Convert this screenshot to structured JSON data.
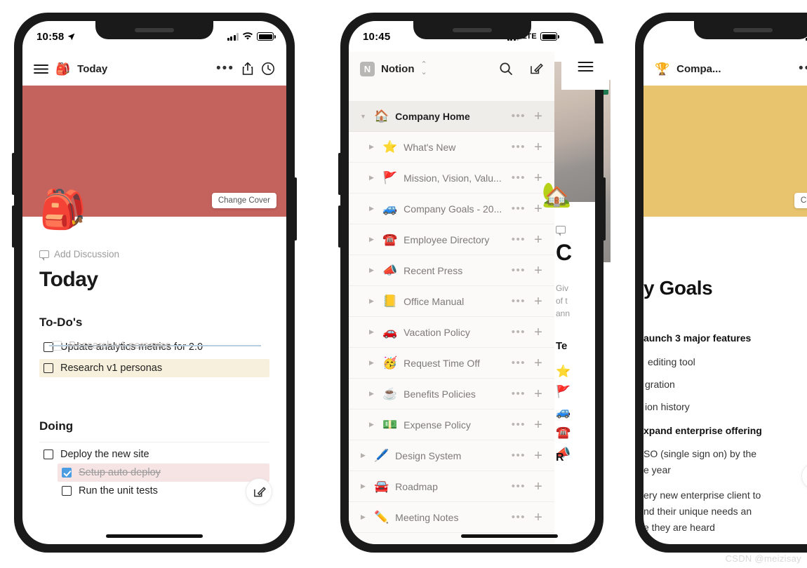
{
  "watermark": "CSDN @meizisay",
  "phone1": {
    "status": {
      "time": "10:58",
      "signal_icon": "cellular-signal-icon",
      "wifi_icon": "wifi-icon",
      "battery_icon": "battery-icon",
      "location_icon": "location-arrow-icon"
    },
    "topbar": {
      "menu_icon": "hamburger-menu-icon",
      "page_emoji": "🎒",
      "title": "Today",
      "more_icon": "more-options-icon",
      "share_icon": "share-icon",
      "history_icon": "history-clock-icon"
    },
    "cover": {
      "color": "#c4625d",
      "change_cover_label": "Change Cover"
    },
    "page_emoji": "🎒",
    "discussion_label": "Add Discussion",
    "page_title": "Today",
    "sections": [
      {
        "heading": "To-Do's",
        "dragging_item": "Research v1 personas",
        "items": [
          {
            "text": "Update analytics metrics for 2.0",
            "checked": false,
            "highlight": "none"
          },
          {
            "text": "Research v1 personas",
            "checked": false,
            "highlight": "yellow"
          }
        ]
      },
      {
        "heading": "Doing",
        "items": [
          {
            "text": "Deploy the new site",
            "checked": false,
            "highlight": "none",
            "indent": false
          },
          {
            "text": "Setup auto deploy",
            "checked": true,
            "highlight": "pink",
            "indent": true
          },
          {
            "text": "Run the unit tests",
            "checked": false,
            "highlight": "none",
            "indent": true
          }
        ]
      }
    ],
    "fab_icon": "compose-edit-icon"
  },
  "phone2": {
    "status": {
      "time": "10:45",
      "network": "LTE",
      "signal_icon": "cellular-signal-icon",
      "battery_icon": "battery-icon"
    },
    "topbar": {
      "logo_letter": "N",
      "workspace": "Notion",
      "switcher_icon": "up-down-chevron-icon",
      "search_icon": "search-icon",
      "compose_icon": "compose-edit-icon"
    },
    "nav": [
      {
        "emoji": "🏠",
        "label": "Company Home",
        "root": true,
        "caret": "▼",
        "more_icon": "more-options-icon",
        "add_icon": "add-page-icon"
      },
      {
        "emoji": "⭐",
        "label": "What's New",
        "root": false,
        "caret": "▶",
        "more_icon": "more-options-icon",
        "add_icon": "add-page-icon"
      },
      {
        "emoji": "🚩",
        "label": "Mission, Vision, Valu...",
        "root": false,
        "caret": "▶",
        "more_icon": "more-options-icon",
        "add_icon": "add-page-icon"
      },
      {
        "emoji": "🚙",
        "label": "Company Goals - 20...",
        "root": false,
        "caret": "▶",
        "more_icon": "more-options-icon",
        "add_icon": "add-page-icon"
      },
      {
        "emoji": "☎️",
        "label": "Employee Directory",
        "root": false,
        "caret": "▶",
        "more_icon": "more-options-icon",
        "add_icon": "add-page-icon"
      },
      {
        "emoji": "📣",
        "label": "Recent Press",
        "root": false,
        "caret": "▶",
        "more_icon": "more-options-icon",
        "add_icon": "add-page-icon"
      },
      {
        "emoji": "📒",
        "label": "Office Manual",
        "root": false,
        "caret": "▶",
        "more_icon": "more-options-icon",
        "add_icon": "add-page-icon"
      },
      {
        "emoji": "🚗",
        "label": "Vacation Policy",
        "root": false,
        "caret": "▶",
        "more_icon": "more-options-icon",
        "add_icon": "add-page-icon"
      },
      {
        "emoji": "🥳",
        "label": "Request Time Off",
        "root": false,
        "caret": "▶",
        "more_icon": "more-options-icon",
        "add_icon": "add-page-icon"
      },
      {
        "emoji": "☕",
        "label": "Benefits Policies",
        "root": false,
        "caret": "▶",
        "more_icon": "more-options-icon",
        "add_icon": "add-page-icon"
      },
      {
        "emoji": "💵",
        "label": "Expense Policy",
        "root": false,
        "caret": "▶",
        "more_icon": "more-options-icon",
        "add_icon": "add-page-icon"
      },
      {
        "emoji": "🖊️",
        "label": "Design System",
        "root": false,
        "caret": "▶",
        "top": true,
        "more_icon": "more-options-icon",
        "add_icon": "add-page-icon"
      },
      {
        "emoji": "🚘",
        "label": "Roadmap",
        "root": false,
        "caret": "▶",
        "top": true,
        "more_icon": "more-options-icon",
        "add_icon": "add-page-icon"
      },
      {
        "emoji": "✏️",
        "label": "Meeting Notes",
        "root": false,
        "caret": "▶",
        "top": true,
        "more_icon": "more-options-icon",
        "add_icon": "add-page-icon"
      }
    ]
  },
  "peek": {
    "emoji": "🏡",
    "discussion_icon": "comment-icon",
    "title_fragment": "C",
    "body_fragments": [
      "Giv",
      "of t",
      "ann"
    ],
    "section_fragment": "Te",
    "emojis": [
      "⭐",
      "🚩",
      "🚙",
      "☎️",
      "📣"
    ],
    "bottom_fragment": "R"
  },
  "phone3": {
    "status": {
      "signal_icon": "cellular-signal-icon",
      "wifi_icon": "wifi-icon",
      "battery_icon": "battery-icon"
    },
    "topbar": {
      "page_emoji": "🏆",
      "title": "Compa...",
      "more_icon": "more-options-icon",
      "share_icon": "share-icon",
      "history_icon": "history-clock-icon",
      "menu_icon": "hamburger-menu-icon"
    },
    "cover": {
      "color": "#e8c46e",
      "change_cover_label": "Change Cover"
    },
    "page_title": "y Goals",
    "lines": [
      {
        "text": "aunch 3 major features",
        "bold": true
      },
      {
        "text": "editing tool",
        "bold": false
      },
      {
        "text": "gration",
        "bold": false
      },
      {
        "text": "ion history",
        "bold": false
      },
      {
        "text": "xpand enterprise offering",
        "bold": true
      },
      {
        "text": "SO (single sign on) by the",
        "bold": false
      },
      {
        "text": "e year",
        "bold": false
      },
      {
        "text": "ery new enterprise client to",
        "bold": false
      },
      {
        "text": "nd their unique needs an",
        "bold": false
      },
      {
        "text": "e they are heard",
        "bold": false
      }
    ],
    "fab_icon": "compose-edit-icon"
  }
}
